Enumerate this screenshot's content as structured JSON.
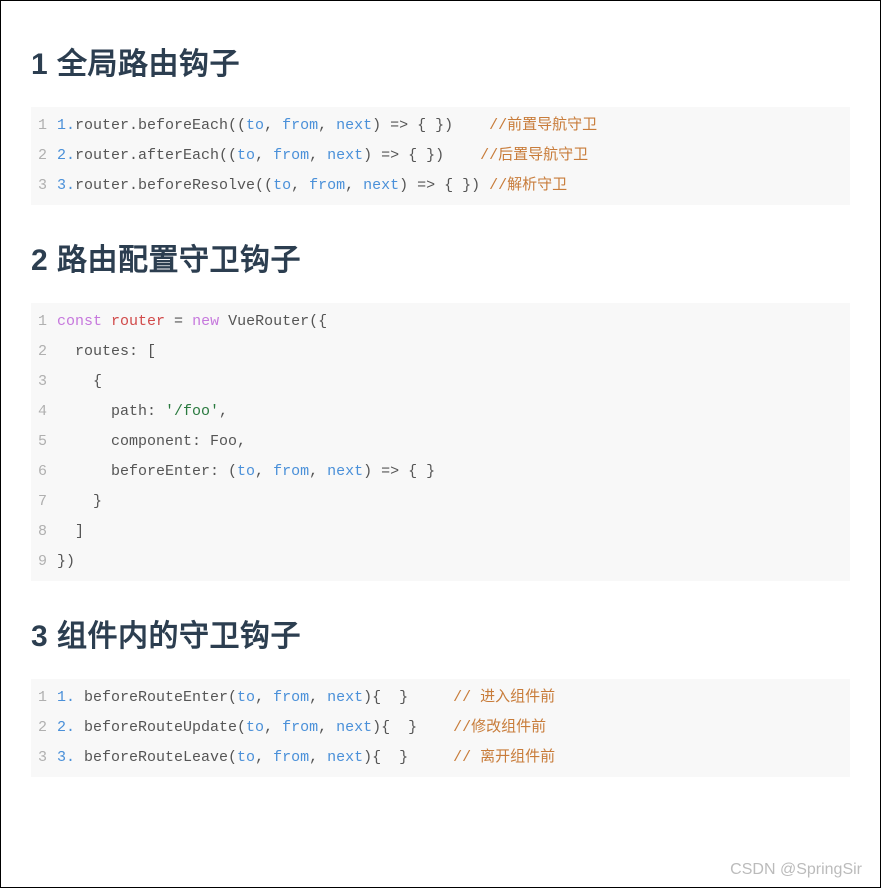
{
  "watermark": "CSDN @SpringSir",
  "sections": [
    {
      "heading": "1 全局路由钩子",
      "code": [
        [
          {
            "t": "num",
            "v": "1."
          },
          {
            "t": "plain",
            "v": "router.beforeEach(("
          },
          {
            "t": "num",
            "v": "to"
          },
          {
            "t": "plain",
            "v": ", "
          },
          {
            "t": "num",
            "v": "from"
          },
          {
            "t": "plain",
            "v": ", "
          },
          {
            "t": "num",
            "v": "next"
          },
          {
            "t": "plain",
            "v": ") => { })    "
          },
          {
            "t": "cmt",
            "v": "//前置导航守卫"
          }
        ],
        [
          {
            "t": "num",
            "v": "2."
          },
          {
            "t": "plain",
            "v": "router.afterEach(("
          },
          {
            "t": "num",
            "v": "to"
          },
          {
            "t": "plain",
            "v": ", "
          },
          {
            "t": "num",
            "v": "from"
          },
          {
            "t": "plain",
            "v": ", "
          },
          {
            "t": "num",
            "v": "next"
          },
          {
            "t": "plain",
            "v": ") => { })    "
          },
          {
            "t": "cmt",
            "v": "//后置导航守卫"
          }
        ],
        [
          {
            "t": "num",
            "v": "3."
          },
          {
            "t": "plain",
            "v": "router.beforeResolve(("
          },
          {
            "t": "num",
            "v": "to"
          },
          {
            "t": "plain",
            "v": ", "
          },
          {
            "t": "num",
            "v": "from"
          },
          {
            "t": "plain",
            "v": ", "
          },
          {
            "t": "num",
            "v": "next"
          },
          {
            "t": "plain",
            "v": ") => { }) "
          },
          {
            "t": "cmt",
            "v": "//解析守卫"
          }
        ]
      ]
    },
    {
      "heading": "2 路由配置守卫钩子",
      "code": [
        [
          {
            "t": "kw",
            "v": "const"
          },
          {
            "t": "plain",
            "v": " "
          },
          {
            "t": "id",
            "v": "router"
          },
          {
            "t": "plain",
            "v": " = "
          },
          {
            "t": "kw",
            "v": "new"
          },
          {
            "t": "plain",
            "v": " VueRouter({"
          }
        ],
        [
          {
            "t": "plain",
            "v": "  routes: ["
          }
        ],
        [
          {
            "t": "plain",
            "v": "    {"
          }
        ],
        [
          {
            "t": "plain",
            "v": "      path: "
          },
          {
            "t": "str",
            "v": "'/foo'"
          },
          {
            "t": "plain",
            "v": ","
          }
        ],
        [
          {
            "t": "plain",
            "v": "      component: Foo,"
          }
        ],
        [
          {
            "t": "plain",
            "v": "      beforeEnter: ("
          },
          {
            "t": "num",
            "v": "to"
          },
          {
            "t": "plain",
            "v": ", "
          },
          {
            "t": "num",
            "v": "from"
          },
          {
            "t": "plain",
            "v": ", "
          },
          {
            "t": "num",
            "v": "next"
          },
          {
            "t": "plain",
            "v": ") => { }"
          }
        ],
        [
          {
            "t": "plain",
            "v": "    }"
          }
        ],
        [
          {
            "t": "plain",
            "v": "  ]"
          }
        ],
        [
          {
            "t": "plain",
            "v": "})"
          }
        ]
      ]
    },
    {
      "heading": "3 组件内的守卫钩子",
      "code": [
        [
          {
            "t": "num",
            "v": "1."
          },
          {
            "t": "plain",
            "v": " beforeRouteEnter("
          },
          {
            "t": "num",
            "v": "to"
          },
          {
            "t": "plain",
            "v": ", "
          },
          {
            "t": "num",
            "v": "from"
          },
          {
            "t": "plain",
            "v": ", "
          },
          {
            "t": "num",
            "v": "next"
          },
          {
            "t": "plain",
            "v": "){  }     "
          },
          {
            "t": "cmt",
            "v": "// 进入组件前"
          }
        ],
        [
          {
            "t": "num",
            "v": "2."
          },
          {
            "t": "plain",
            "v": " beforeRouteUpdate("
          },
          {
            "t": "num",
            "v": "to"
          },
          {
            "t": "plain",
            "v": ", "
          },
          {
            "t": "num",
            "v": "from"
          },
          {
            "t": "plain",
            "v": ", "
          },
          {
            "t": "num",
            "v": "next"
          },
          {
            "t": "plain",
            "v": "){  }    "
          },
          {
            "t": "cmt",
            "v": "//修改组件前"
          }
        ],
        [
          {
            "t": "num",
            "v": "3."
          },
          {
            "t": "plain",
            "v": " beforeRouteLeave("
          },
          {
            "t": "num",
            "v": "to"
          },
          {
            "t": "plain",
            "v": ", "
          },
          {
            "t": "num",
            "v": "from"
          },
          {
            "t": "plain",
            "v": ", "
          },
          {
            "t": "num",
            "v": "next"
          },
          {
            "t": "plain",
            "v": "){  }     "
          },
          {
            "t": "cmt",
            "v": "// 离开组件前"
          }
        ]
      ]
    }
  ]
}
